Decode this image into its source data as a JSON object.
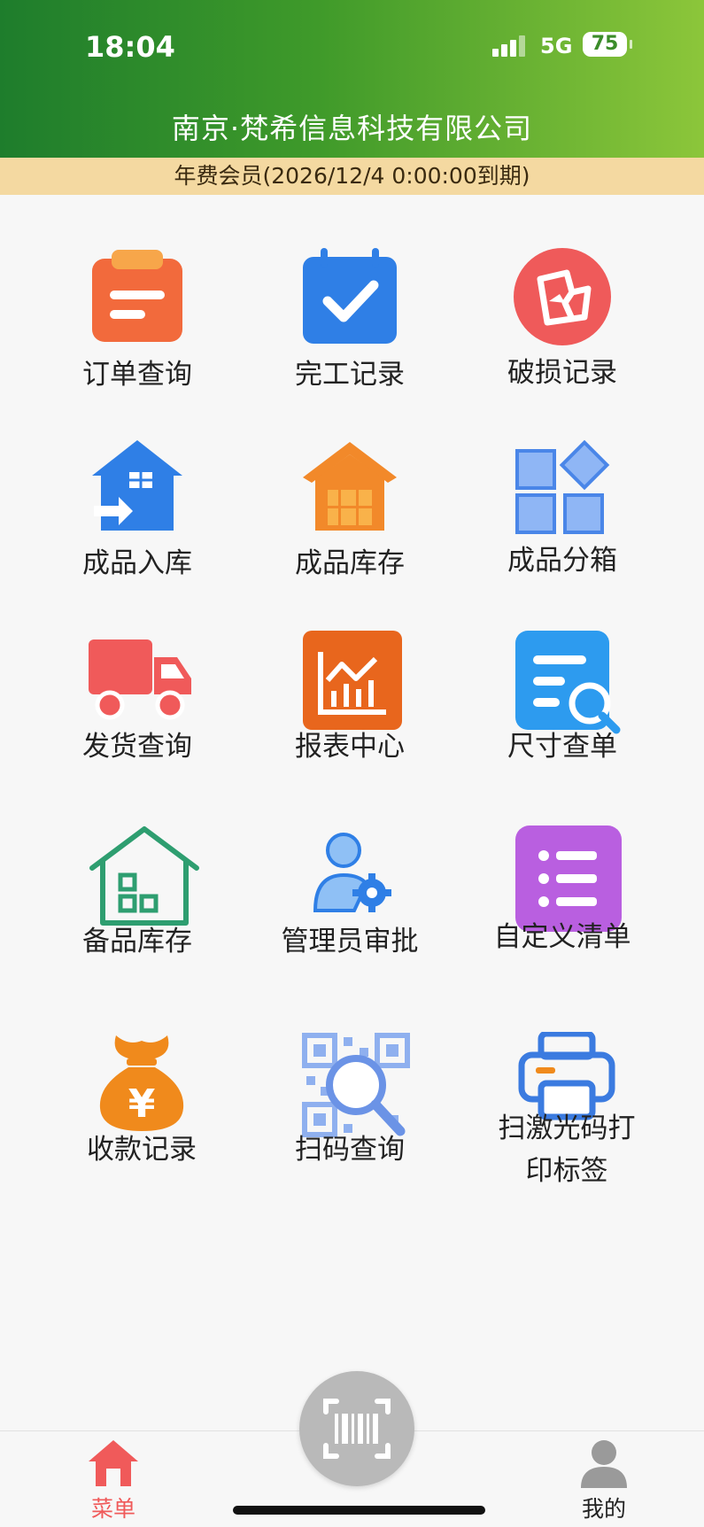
{
  "status_bar": {
    "time": "18:04",
    "network": "5G",
    "battery": "75"
  },
  "header": {
    "company": "南京·梵希信息科技有限公司",
    "membership": "年费会员(2026/12/4 0:00:00到期)"
  },
  "menu": [
    {
      "label": "订单查询",
      "icon": "clipboard-icon",
      "color": "#f26a3c"
    },
    {
      "label": "完工记录",
      "icon": "calendar-check-icon",
      "color": "#2f7fe6"
    },
    {
      "label": "破损记录",
      "icon": "broken-photo-icon",
      "color": "#ef5a5a"
    },
    {
      "label": "成品入库",
      "icon": "warehouse-in-icon",
      "color": "#2f7fe6"
    },
    {
      "label": "成品库存",
      "icon": "warehouse-stock-icon",
      "color": "#f2892a"
    },
    {
      "label": "成品分箱",
      "icon": "blocks-icon",
      "color": "#4a86e8"
    },
    {
      "label": "发货查询",
      "icon": "truck-icon",
      "color": "#f05a5a"
    },
    {
      "label": "报表中心",
      "icon": "chart-icon",
      "color": "#e8661d"
    },
    {
      "label": "尺寸查单",
      "icon": "doc-search-icon",
      "color": "#2d9bef"
    },
    {
      "label": "备品库存",
      "icon": "spare-house-icon",
      "color": "#2e9e70"
    },
    {
      "label": "管理员审批",
      "icon": "admin-gear-icon",
      "color": "#2f7fe6"
    },
    {
      "label": "自定义清单",
      "icon": "list-icon",
      "color": "#b95fe0"
    },
    {
      "label": "收款记录",
      "icon": "money-bag-icon",
      "color": "#f08a1c"
    },
    {
      "label": "扫码查询",
      "icon": "qr-search-icon",
      "color": "#6b93e6"
    },
    {
      "label": "扫激光码打印标签",
      "label_line1": "扫激光码打",
      "label_line2": "印标签",
      "icon": "printer-icon",
      "color": "#3b7be0"
    }
  ],
  "tabbar": {
    "home_label": "菜单",
    "profile_label": "我的",
    "active_color": "#f05a5a"
  }
}
